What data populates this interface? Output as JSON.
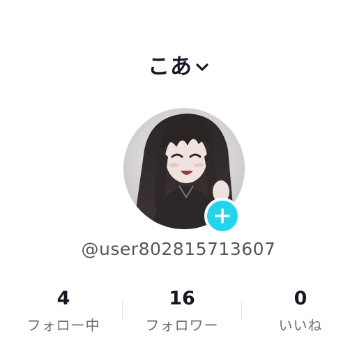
{
  "header": {
    "title": "こあ",
    "dropdown_icon": "chevron-down-icon"
  },
  "profile": {
    "handle": "@user802815713607",
    "avatar_description": "anime-style illustration",
    "add_icon": "plus-icon",
    "accent_color": "#20d5ec"
  },
  "stats": [
    {
      "value": "4",
      "label": "フォロー中"
    },
    {
      "value": "16",
      "label": "フォロワー"
    },
    {
      "value": "0",
      "label": "いいね"
    }
  ]
}
